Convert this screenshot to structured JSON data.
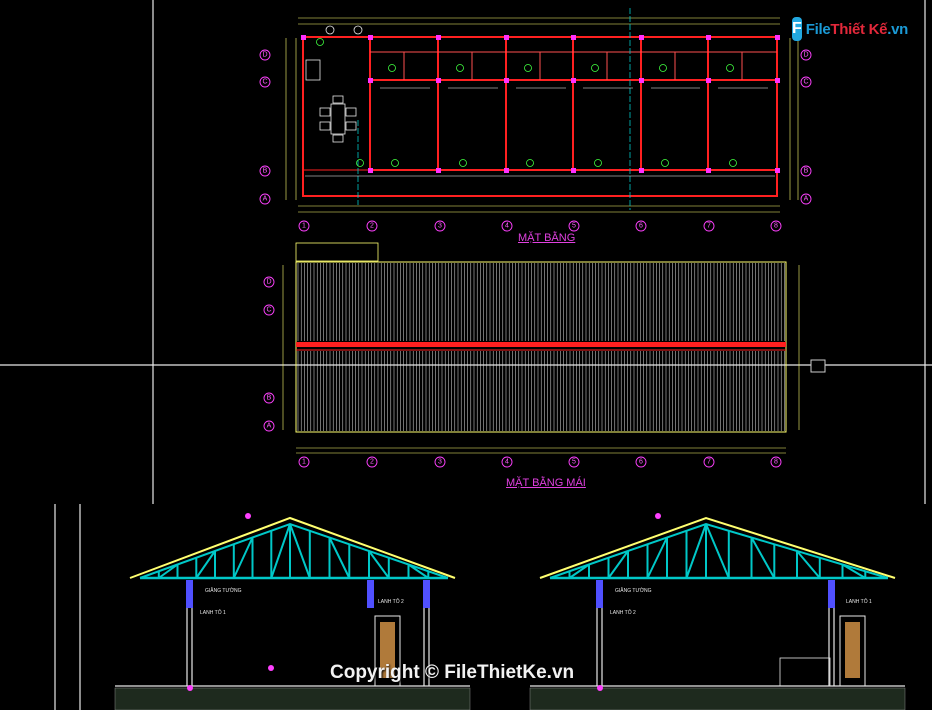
{
  "logo": {
    "prefix": "File",
    "name": "Thiết Kế",
    "suffix": ".vn"
  },
  "plans": {
    "floor_title": "MẶT BẰNG",
    "roof_title": "MẶT BẰNG MÁI",
    "axis_numbers": [
      "1",
      "2",
      "3",
      "4",
      "5",
      "6",
      "7",
      "8"
    ],
    "axis_letters": [
      "D",
      "C",
      "B",
      "A"
    ]
  },
  "sections": {
    "labels": [
      "GIẰNG TƯỜNG",
      "LANH TÔ 1",
      "LANH TÔ 2"
    ]
  },
  "watermark": "Copyright © FileThietKe.vn",
  "colors": {
    "background": "#000000",
    "wall": "#ff2020",
    "grid": "#ffff60",
    "truss": "#00c8c8",
    "title": "#e040e0"
  }
}
